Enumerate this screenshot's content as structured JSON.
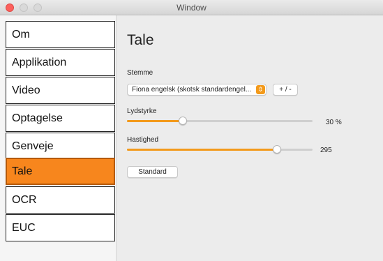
{
  "window": {
    "title": "Window"
  },
  "sidebar": {
    "items": [
      {
        "label": "Om"
      },
      {
        "label": "Applikation"
      },
      {
        "label": "Video"
      },
      {
        "label": "Optagelse"
      },
      {
        "label": "Genveje"
      },
      {
        "label": "Tale",
        "selected": true
      },
      {
        "label": "OCR"
      },
      {
        "label": "EUC"
      }
    ]
  },
  "main": {
    "title": "Tale",
    "voice": {
      "label": "Stemme",
      "selected": "Fiona engelsk (skotsk standardengel...",
      "add_remove_label": "+ / -"
    },
    "volume": {
      "label": "Lydstyrke",
      "value": 30,
      "value_text": "30 %"
    },
    "speed": {
      "label": "Hastighed",
      "value": 295,
      "fraction": 0.81,
      "value_text": "295"
    },
    "default_button_label": "Standard"
  },
  "colors": {
    "accent": "#f39a1b",
    "selected_item": "#f7861d"
  }
}
